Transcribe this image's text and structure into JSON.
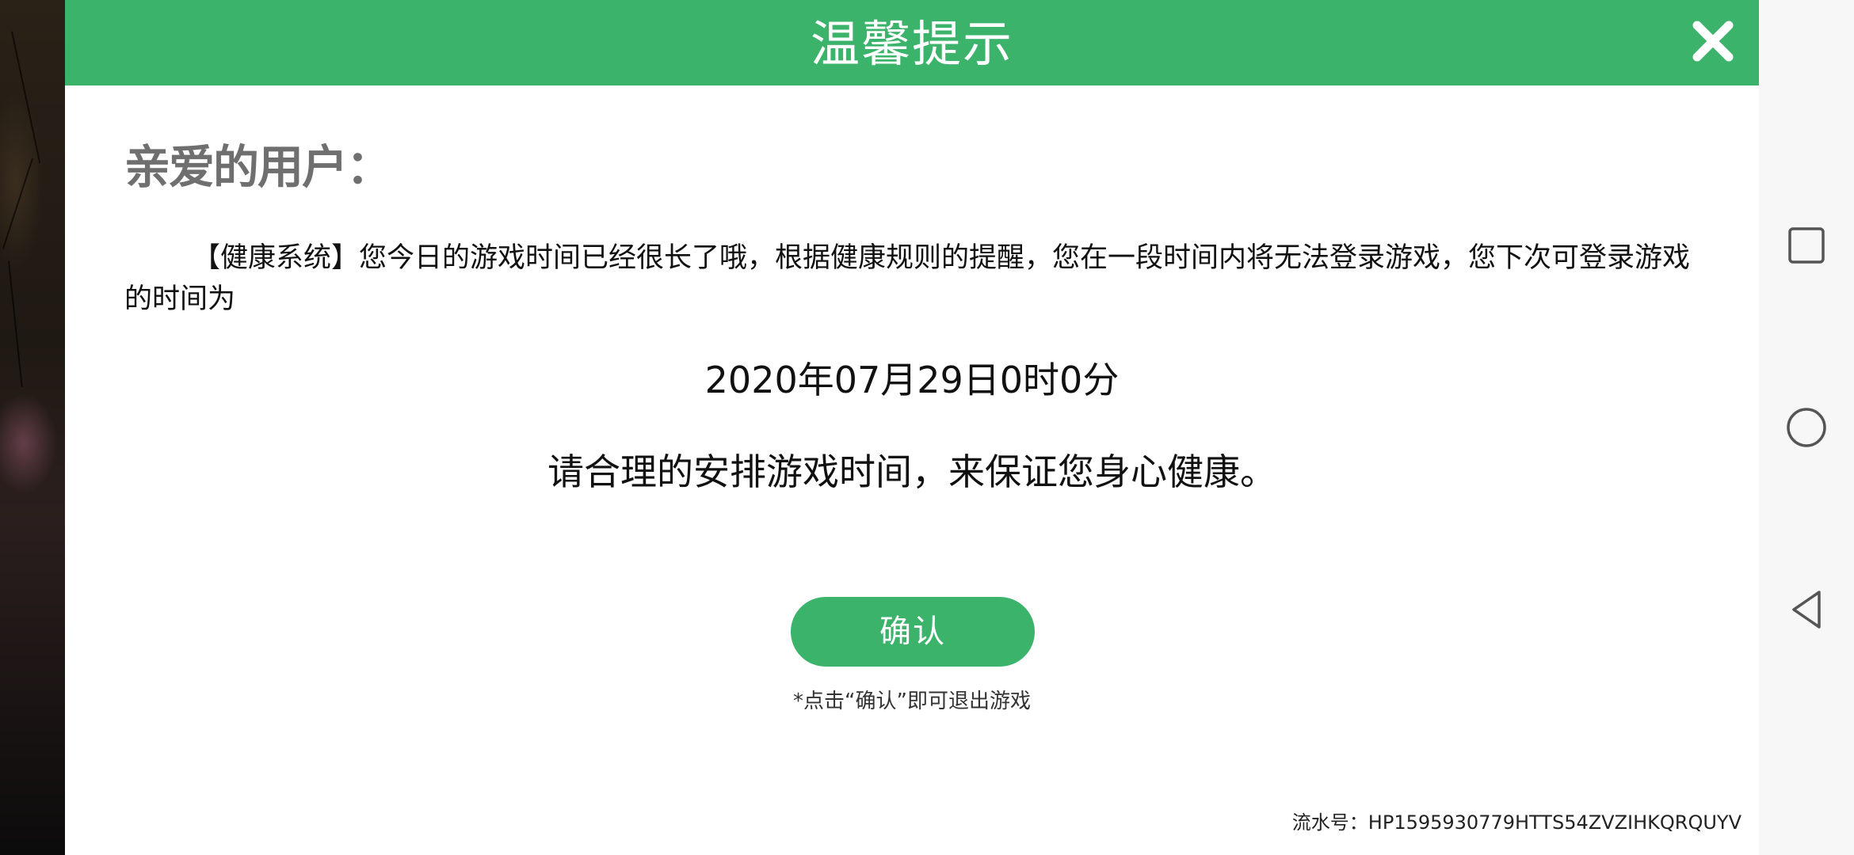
{
  "dialog": {
    "title": "温馨提示",
    "greeting": "亲爱的用户：",
    "message": "【健康系统】您今日的游戏时间已经很长了哦，根据健康规则的提醒，您在一段时间内将无法登录游戏，您下次可登录游戏的时间为",
    "next_login_time": "2020年07月29日0时0分",
    "advice": "请合理的安排游戏时间，来保证您身心健康。",
    "confirm_label": "确认",
    "hint": "*点击“确认”即可退出游戏",
    "serial_number": "流水号：HP1595930779HTTS54ZVZIHKQRQUYV"
  },
  "colors": {
    "accent": "#3bb36b",
    "greeting_text": "#6f6f6f",
    "navbar_bg": "#f7f7f7"
  },
  "icons": {
    "close": "close-icon",
    "nav_recent": "square-icon",
    "nav_home": "circle-icon",
    "nav_back": "triangle-back-icon"
  }
}
